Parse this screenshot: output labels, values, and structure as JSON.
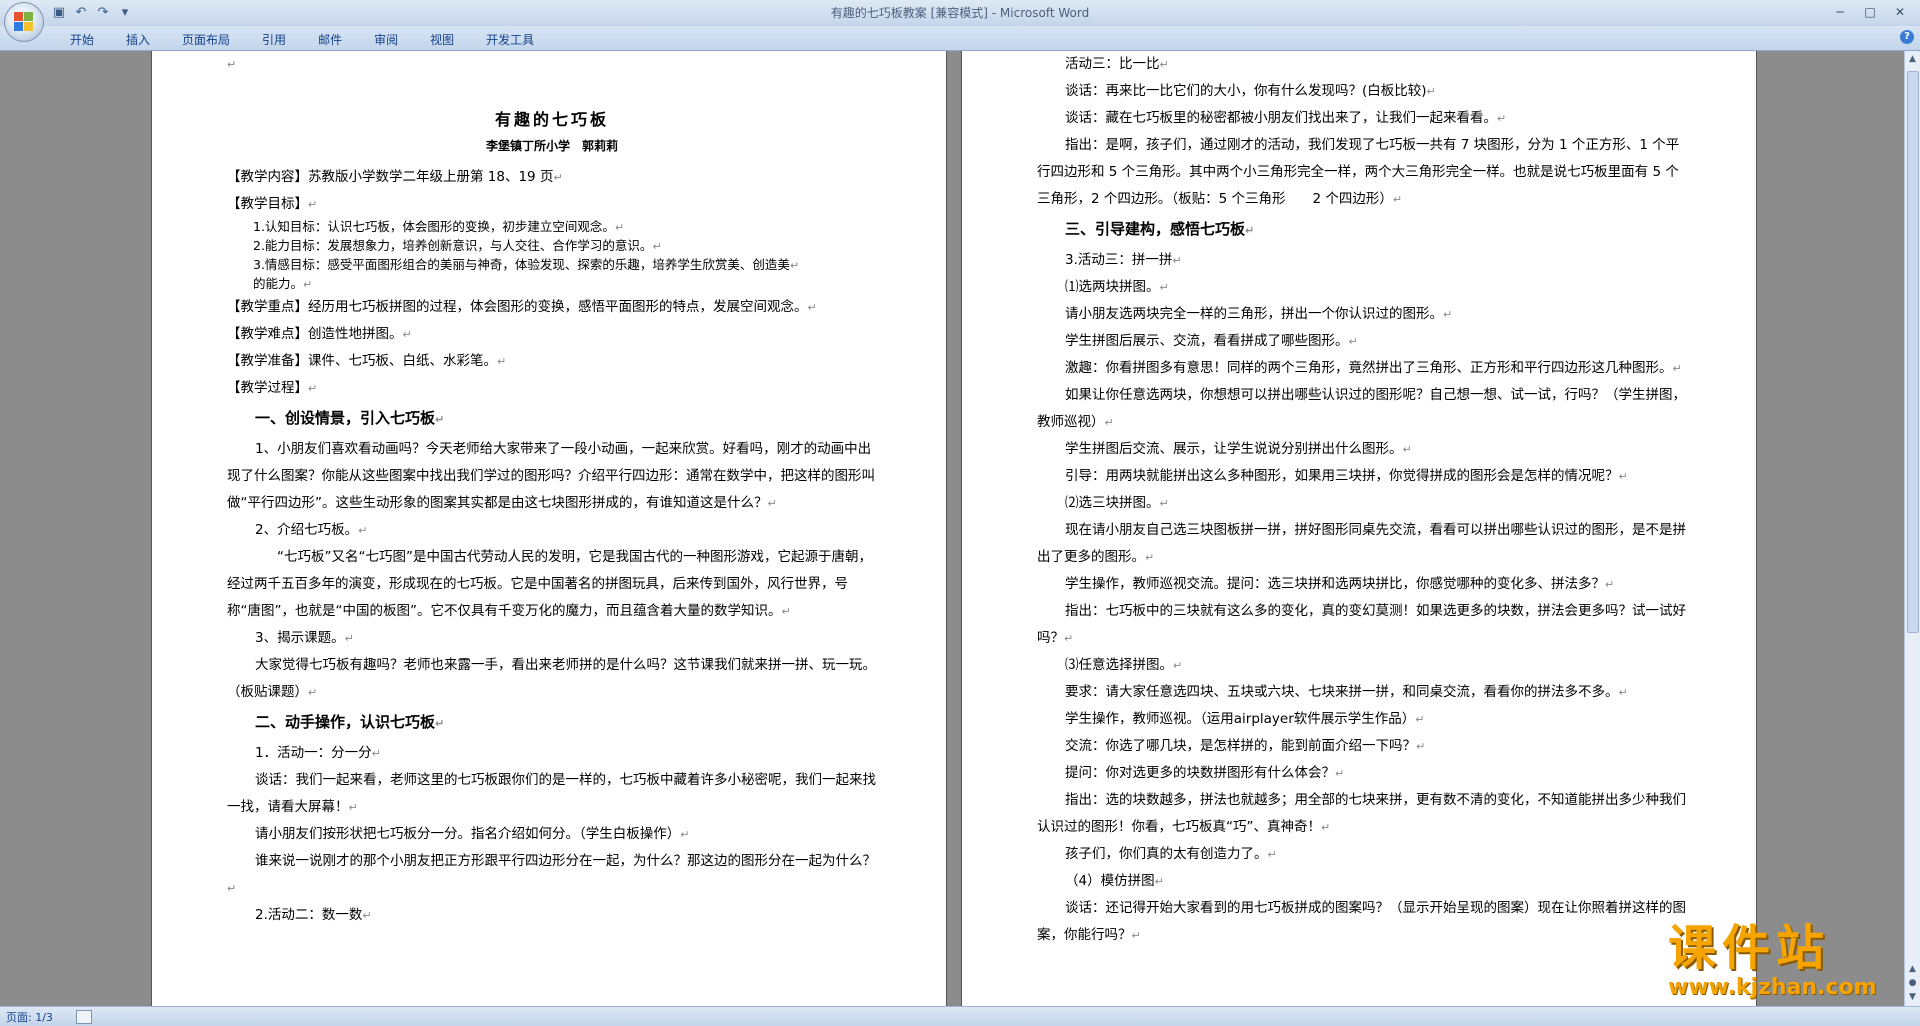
{
  "window": {
    "title": "有趣的七巧板教案 [兼容模式] - Microsoft Word"
  },
  "quick_access": [
    {
      "icon": "save-icon",
      "glyph": "▣"
    },
    {
      "icon": "undo-icon",
      "glyph": "↶"
    },
    {
      "icon": "redo-icon",
      "glyph": "↷"
    },
    {
      "icon": "customize-icon",
      "glyph": "▾"
    }
  ],
  "ribbon": {
    "tabs": [
      "开始",
      "插入",
      "页面布局",
      "引用",
      "邮件",
      "审阅",
      "视图",
      "开发工具"
    ]
  },
  "window_controls": {
    "minimize": "─",
    "maximize": "□",
    "close": "✕"
  },
  "status": {
    "page": "页面: 1/3"
  },
  "watermark": {
    "title": "课件站",
    "url": "www.kjzhan.com"
  },
  "left_page": {
    "title": "有趣的七巧板",
    "author": "李堡镇丁所小学　郭莉莉",
    "paras": [
      {
        "cls": "para",
        "text": "【教学内容】苏教版小学数学二年级上册第 18、19 页"
      },
      {
        "cls": "para",
        "text": "【教学目标】"
      },
      {
        "cls": "small",
        "text": "1.认知目标：认识七巧板，体会图形的变换，初步建立空间观念。"
      },
      {
        "cls": "small",
        "text": "2.能力目标：发展想象力，培养创新意识，与人交往、合作学习的意识。"
      },
      {
        "cls": "small",
        "text": "3.情感目标：感受平面图形组合的美丽与神奇，体验发现、探索的乐趣，培养学生欣赏美、创造美"
      },
      {
        "cls": "small",
        "text": "的能力。"
      },
      {
        "cls": "para",
        "text": "【教学重点】经历用七巧板拼图的过程，体会图形的变换，感悟平面图形的特点，发展空间观念。"
      },
      {
        "cls": "para",
        "text": "【教学难点】创造性地拼图。"
      },
      {
        "cls": "para",
        "text": "【教学准备】课件、七巧板、白纸、水彩笔。"
      },
      {
        "cls": "para",
        "text": "【教学过程】"
      },
      {
        "cls": "heading h-indent",
        "text": "一、创设情景，引入七巧板"
      },
      {
        "cls": "para indent",
        "text": "1、小朋友们喜欢看动画吗？今天老师给大家带来了一段小动画，一起来欣赏。好看吗，刚才的动画中出现了什么图案？你能从这些图案中找出我们学过的图形吗？介绍平行四边形：通常在数学中，把这样的图形叫做“平行四边形”。这些生动形象的图案其实都是由这七块图形拼成的，有谁知道这是什么？"
      },
      {
        "cls": "para indent",
        "text": "2、介绍七巧板。"
      },
      {
        "cls": "para indent2",
        "text": "“七巧板”又名“七巧图”是中国古代劳动人民的发明，它是我国古代的一种图形游戏，它起源于唐朝，经过两千五百多年的演变，形成现在的七巧板。它是中国著名的拼图玩具，后来传到国外，风行世界，号称“唐图”，也就是“中国的板图”。它不仅具有千变万化的魔力，而且蕴含着大量的数学知识。"
      },
      {
        "cls": "para indent",
        "text": "3、揭示课题。"
      },
      {
        "cls": "para indent",
        "text": "大家觉得七巧板有趣吗？老师也来露一手，看出来老师拼的是什么吗？这节课我们就来拼一拼、玩一玩。（板贴课题）"
      },
      {
        "cls": "heading h-indent",
        "text": "二、动手操作，认识七巧板"
      },
      {
        "cls": "para indent",
        "text": "1．活动一：分一分"
      },
      {
        "cls": "para indent",
        "text": "谈话：我们一起来看，老师这里的七巧板跟你们的是一样的，七巧板中藏着许多小秘密呢，我们一起来找一找，请看大屏幕！"
      },
      {
        "cls": "para indent",
        "text": "请小朋友们按形状把七巧板分一分。指名介绍如何分。（学生白板操作）"
      },
      {
        "cls": "para indent",
        "text": "谁来说一说刚才的那个小朋友把正方形跟平行四边形分在一起，为什么？那这边的图形分在一起为什么？"
      },
      {
        "cls": "para indent",
        "text": "2.活动二：数一数"
      }
    ]
  },
  "right_page": {
    "paras": [
      {
        "cls": "para indent",
        "text": "活动三：比一比"
      },
      {
        "cls": "para indent",
        "text": "谈话：再来比一比它们的大小，你有什么发现吗？(白板比较)"
      },
      {
        "cls": "para indent",
        "text": "谈话：藏在七巧板里的秘密都被小朋友们找出来了，让我们一起来看看。"
      },
      {
        "cls": "para indent",
        "text": "指出：是啊，孩子们，通过刚才的活动，我们发现了七巧板一共有 7 块图形，分为 1 个正方形、1 个平行四边形和 5 个三角形。其中两个小三角形完全一样，两个大三角形完全一样。也就是说七巧板里面有 5 个三角形，2 个四边形。（板贴：5 个三角形　　2 个四边形）"
      },
      {
        "cls": "heading h-indent",
        "text": "三、引导建构，感悟七巧板"
      },
      {
        "cls": "para indent",
        "text": "3.活动三：拼一拼"
      },
      {
        "cls": "para indent",
        "text": "⑴选两块拼图。"
      },
      {
        "cls": "para indent",
        "text": "请小朋友选两块完全一样的三角形，拼出一个你认识过的图形。"
      },
      {
        "cls": "para indent",
        "text": "学生拼图后展示、交流，看看拼成了哪些图形。"
      },
      {
        "cls": "para indent",
        "text": "激趣：你看拼图多有意思！同样的两个三角形，竟然拼出了三角形、正方形和平行四边形这几种图形。"
      },
      {
        "cls": "para indent",
        "text": "如果让你任意选两块，你想想可以拼出哪些认识过的图形呢？自己想一想、试一试，行吗？（学生拼图，教师巡视）"
      },
      {
        "cls": "para indent",
        "text": "学生拼图后交流、展示，让学生说说分别拼出什么图形。"
      },
      {
        "cls": "para indent",
        "text": "引导：用两块就能拼出这么多种图形，如果用三块拼，你觉得拼成的图形会是怎样的情况呢？"
      },
      {
        "cls": "para indent",
        "text": "⑵选三块拼图。"
      },
      {
        "cls": "para indent",
        "text": "现在请小朋友自己选三块图板拼一拼，拼好图形同桌先交流，看看可以拼出哪些认识过的图形，是不是拼出了更多的图形。"
      },
      {
        "cls": "para indent",
        "text": "学生操作，教师巡视交流。提问：选三块拼和选两块拼比，你感觉哪种的变化多、拼法多？"
      },
      {
        "cls": "para indent",
        "text": "指出：七巧板中的三块就有这么多的变化，真的变幻莫测！如果选更多的块数，拼法会更多吗？试一试好吗？"
      },
      {
        "cls": "para indent",
        "text": "⑶任意选择拼图。"
      },
      {
        "cls": "para indent",
        "text": "要求：请大家任意选四块、五块或六块、七块来拼一拼，和同桌交流，看看你的拼法多不多。"
      },
      {
        "cls": "para indent",
        "text": "学生操作，教师巡视。（运用airplayer软件展示学生作品）"
      },
      {
        "cls": "para indent",
        "text": "交流：你选了哪几块，是怎样拼的，能到前面介绍一下吗？"
      },
      {
        "cls": "para indent",
        "text": "提问：你对选更多的块数拼图形有什么体会？"
      },
      {
        "cls": "para indent",
        "text": "指出：选的块数越多，拼法也就越多；用全部的七块来拼，更有数不清的变化，不知道能拼出多少种我们认识过的图形！你看，七巧板真“巧”、真神奇！"
      },
      {
        "cls": "para indent",
        "text": "孩子们，你们真的太有创造力了。"
      },
      {
        "cls": "para indent",
        "text": "（4）模仿拼图"
      },
      {
        "cls": "para indent",
        "text": "谈话：还记得开始大家看到的用七巧板拼成的图案吗？（显示开始呈现的图案）现在让你照着拼这样的图案，你能行吗？"
      }
    ]
  }
}
